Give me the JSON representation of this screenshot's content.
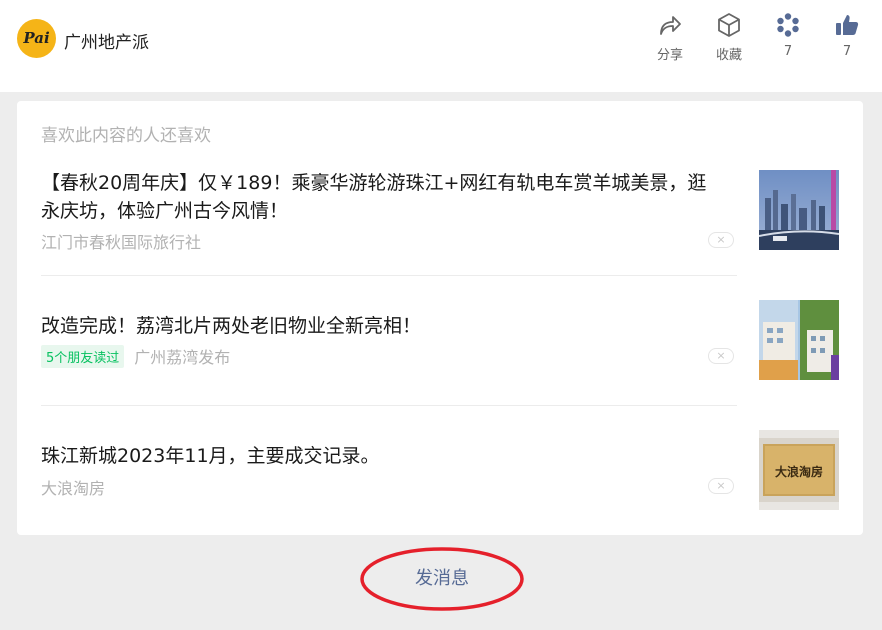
{
  "header": {
    "account_name": "广州地产派",
    "logo_text": "Pai",
    "actions": {
      "share_label": "分享",
      "favorite_label": "收藏",
      "star_count": "7",
      "like_count": "7"
    }
  },
  "recommend": {
    "section_title": "喜欢此内容的人还喜欢",
    "items": [
      {
        "title": "【春秋20周年庆】仅￥189！乘豪华游轮游珠江+网红有轨电车赏羊城美景，逛永庆坊，体验广州古今风情！",
        "badge": "",
        "source": "江门市春秋国际旅行社",
        "close_icon": "×"
      },
      {
        "title": "改造完成！荔湾北片两处老旧物业全新亮相！",
        "badge": "5个朋友读过",
        "source": "广州荔湾发布",
        "close_icon": "×"
      },
      {
        "title": "珠江新城2023年11月，主要成交记录。",
        "badge": "",
        "source": "大浪淘房",
        "close_icon": "×",
        "thumb_text": "大浪淘房"
      }
    ]
  },
  "footer": {
    "send_message_label": "发消息"
  },
  "colors": {
    "link_blue": "#576b95",
    "logo_yellow": "#f5b417",
    "badge_green": "#07c160",
    "annotation_red": "#e5202b"
  }
}
